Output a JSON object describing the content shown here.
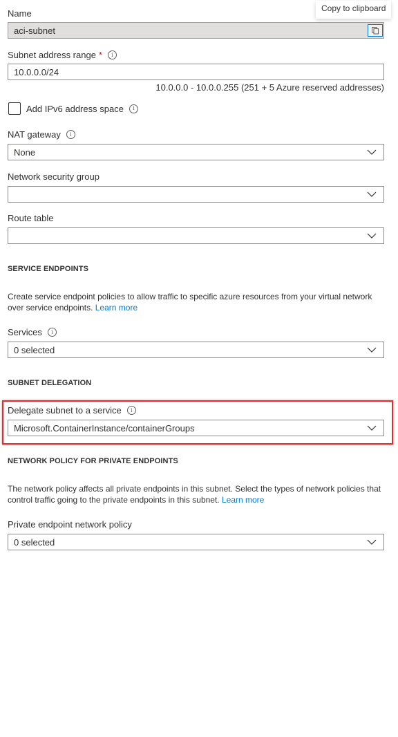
{
  "tooltip": {
    "text": "Copy to clipboard"
  },
  "name": {
    "label": "Name",
    "value": "aci-subnet",
    "copy_icon": "copy-icon"
  },
  "subnet_range": {
    "label": "Subnet address range",
    "required_marker": "*",
    "value": "10.0.0.0/24",
    "hint": "10.0.0.0 - 10.0.0.255 (251 + 5 Azure reserved addresses)"
  },
  "ipv6": {
    "label": "Add IPv6 address space",
    "checked": false
  },
  "nat_gateway": {
    "label": "NAT gateway",
    "value": "None"
  },
  "nsg": {
    "label": "Network security group",
    "value": ""
  },
  "route_table": {
    "label": "Route table",
    "value": ""
  },
  "service_endpoints": {
    "title": "SERVICE ENDPOINTS",
    "description": "Create service endpoint policies to allow traffic to specific azure resources from your virtual network over service endpoints.",
    "link": "Learn more",
    "services_label": "Services",
    "services_value": "0 selected"
  },
  "subnet_delegation": {
    "title": "SUBNET DELEGATION",
    "label": "Delegate subnet to a service",
    "value": "Microsoft.ContainerInstance/containerGroups",
    "highlight_color": "#e02c2c"
  },
  "network_policy": {
    "title": "NETWORK POLICY FOR PRIVATE ENDPOINTS",
    "description": "The network policy affects all private endpoints in this subnet. Select the types of network policies that control traffic going to the private endpoints in this subnet.",
    "link": "Learn more",
    "label": "Private endpoint network policy",
    "value": "0 selected"
  },
  "colors": {
    "accent": "#0078d4",
    "required": "#a4262c",
    "text": "#323130"
  }
}
